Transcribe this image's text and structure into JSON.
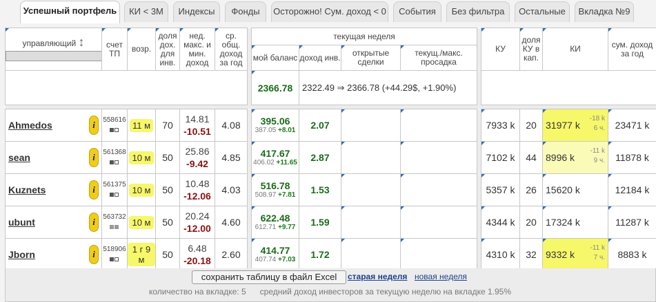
{
  "tabs": [
    {
      "label": "Успешный портфель",
      "active": true
    },
    {
      "label": "КИ < 3М"
    },
    {
      "label": "Индексы"
    },
    {
      "label": "Фонды"
    },
    {
      "label": "Осторожно! Сум. доход < 0"
    },
    {
      "label": "События"
    },
    {
      "label": "Без фильтра"
    },
    {
      "label": "Остальные"
    },
    {
      "label": "Вкладка №9"
    }
  ],
  "header": {
    "manager": "управляющий",
    "account": "счет ТП",
    "age": "возр.",
    "share_income": "доля дох. для инв.",
    "week_minmax": "нед. макс. и мин. доход",
    "avg_income": "ср. общ. доход за год",
    "current_week": "текущая неделя",
    "my_balance": "мой баланс",
    "inv_income": "доход инв.",
    "open_deals": "открытые сделки",
    "drawdown": "текущ./макс. просадка",
    "ku": "КУ",
    "ku_share": "доля КУ в кап.",
    "ki": "КИ",
    "sum_income": "сум. доход за год"
  },
  "summary": {
    "balance": "2366.78",
    "change_text": "2322.49 ⇒ 2366.78 (+44.29$, +1.90%)"
  },
  "rows": [
    {
      "name": "Ahmedos",
      "acct": "558616",
      "age": "11 м",
      "share": "70",
      "wmax": "14.81",
      "wmin": "-10.51",
      "avg": "4.08",
      "bal": "395.06",
      "bal_prev": "387.05",
      "bal_delta": "+8.01",
      "inc": "2.07",
      "ku": "7933 k",
      "ku_share": "20",
      "ki": "31977 k",
      "ki_sub1": "-18 k",
      "ki_sub2": "6 ч.",
      "sum": "23471 k"
    },
    {
      "name": "sean",
      "acct": "561368",
      "age": "10 м",
      "share": "50",
      "wmax": "25.86",
      "wmin": "-9.42",
      "avg": "4.85",
      "bal": "417.67",
      "bal_prev": "406.02",
      "bal_delta": "+11.65",
      "inc": "2.87",
      "ku": "7102 k",
      "ku_share": "44",
      "ki": "8996 k",
      "ki_sub1": "-11 k",
      "ki_sub2": "9 ч.",
      "sum": "11878 k"
    },
    {
      "name": "Kuznets",
      "acct": "561375",
      "age": "10 м",
      "share": "50",
      "wmax": "10.48",
      "wmin": "-12.06",
      "avg": "4.03",
      "bal": "516.78",
      "bal_prev": "508.97",
      "bal_delta": "+7.81",
      "inc": "1.53",
      "ku": "5357 k",
      "ku_share": "26",
      "ki": "15620 k",
      "ki_sub1": "",
      "ki_sub2": "",
      "sum": "12184 k"
    },
    {
      "name": "ubunt",
      "acct": "563732",
      "age": "10 м",
      "share": "50",
      "wmax": "20.24",
      "wmin": "-12.00",
      "avg": "4.60",
      "bal": "622.48",
      "bal_prev": "612.71",
      "bal_delta": "+9.77",
      "inc": "1.59",
      "ku": "4344 k",
      "ku_share": "20",
      "ki": "17324 k",
      "ki_sub1": "",
      "ki_sub2": "",
      "sum": "11287 k"
    },
    {
      "name": "Jborn",
      "acct": "518906",
      "age": "1 г 9 м",
      "share": "50",
      "wmax": "6.48",
      "wmin": "-20.18",
      "avg": "2.60",
      "bal": "414.77",
      "bal_prev": "407.74",
      "bal_delta": "+7.03",
      "inc": "1.72",
      "ku": "4310 k",
      "ku_share": "32",
      "ki": "9332 k",
      "ki_sub1": "-11 k",
      "ki_sub2": "7 ч.",
      "sum": "8883 k"
    }
  ],
  "footer": {
    "save_button": "сохранить таблицу в файл Excel",
    "old_week": "старая неделя",
    "new_week": "новая неделя",
    "count_label": "количество на вкладке: 5",
    "avg_label": "средний доход инвесторов за текущую неделю на вкладке 1.95%"
  }
}
